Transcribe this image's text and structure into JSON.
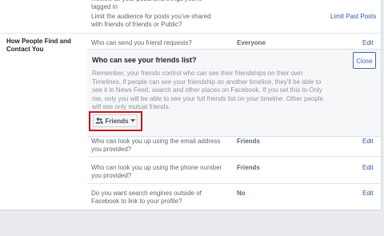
{
  "rows": {
    "top_cut": {
      "question": "Review all your posts and things you're tagged in"
    },
    "limit": {
      "question": "Limit the audience for posts you've shared with friends of friends or Public?",
      "action": "Limit Past Posts"
    },
    "friend_requests": {
      "question": "Who can send you friend requests?",
      "value": "Everyone",
      "edit": "Edit"
    },
    "email": {
      "question": "Who can look you up using the email address you provided?",
      "value": "Friends",
      "edit": "Edit"
    },
    "phone": {
      "question": "Who can look you up using the phone number you provided?",
      "value": "Friends",
      "edit": "Edit"
    },
    "search": {
      "question": "Do you want search engines outside of Facebook to link to your profile?",
      "value": "No",
      "edit": "Edit"
    }
  },
  "section_label": "How People Find and Contact You",
  "expanded": {
    "title": "Who can see your friends list?",
    "description": "Remember, your friends control who can see their friendships on their own Timelines. If people can see your friendship on another timeline, they'll be able to see it in News Feed, search and other places on Facebook. If you set this to Only me, only you will be able to see your full friends list on your timeline. Other people will see only mutual friends.",
    "close_label": "Close",
    "audience_label": "Friends",
    "audience_icon": "friends-icon"
  },
  "colors": {
    "link": "#365899",
    "highlight": "#c4161c",
    "accent": "#4267b2"
  }
}
